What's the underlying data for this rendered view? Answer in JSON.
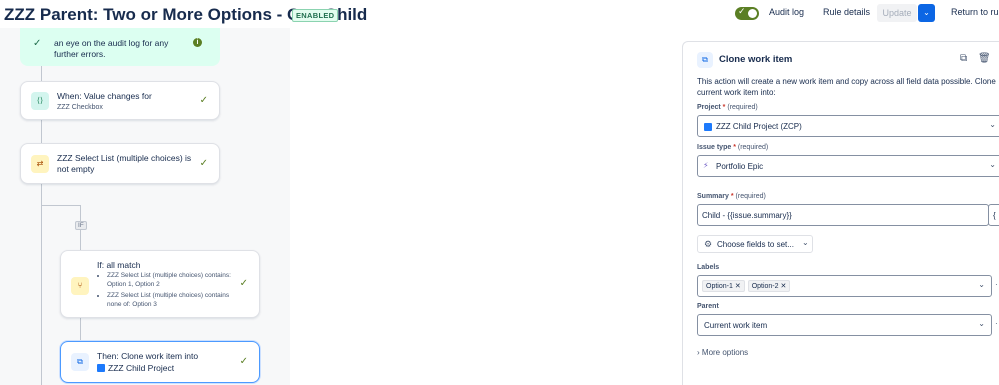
{
  "header": {
    "title": "ZZZ Parent: Two or More Options - One Child",
    "status_badge": "ENABLED",
    "audit_log": "Audit log",
    "rule_details": "Rule details",
    "update": "Update",
    "return": "Return to rule"
  },
  "canvas": {
    "banner_text": "an eye on the audit log for any further errors.",
    "trigger": {
      "title": "When: Value changes for",
      "subtitle": "ZZZ Checkbox"
    },
    "condition": {
      "title": "ZZZ Select List (multiple choices) is not empty"
    },
    "if_tag": "IF",
    "if_block": {
      "title": "If: all match",
      "conditions": [
        "ZZZ Select List (multiple choices) contains: Option 1, Option 2",
        "ZZZ Select List (multiple choices) contains none of: Option 3"
      ]
    },
    "action": {
      "title": "Then: Clone work item into",
      "project": "ZZZ Child Project"
    }
  },
  "panel": {
    "title": "Clone work item",
    "description": "This action will create a new work item and copy across all field data possible. Clone current work item into:",
    "project": {
      "label": "Project",
      "req": "(required)",
      "value": "ZZZ Child Project (ZCP)"
    },
    "issue_type": {
      "label": "Issue type",
      "req": "(required)",
      "value": "Portfolio Epic"
    },
    "summary": {
      "label": "Summary",
      "req": "(required)",
      "value": "Child - {{issue.summary}}",
      "brace": "{"
    },
    "choose_fields": "Choose fields to set...",
    "labels": {
      "label": "Labels",
      "tags": [
        "Option-1",
        "Option-2"
      ]
    },
    "parent": {
      "label": "Parent",
      "value": "Current work item"
    },
    "more_options": "More options"
  },
  "colors": {
    "accent": "#0c66e4",
    "success": "#5b7f24",
    "banner": "#dcfff1"
  }
}
